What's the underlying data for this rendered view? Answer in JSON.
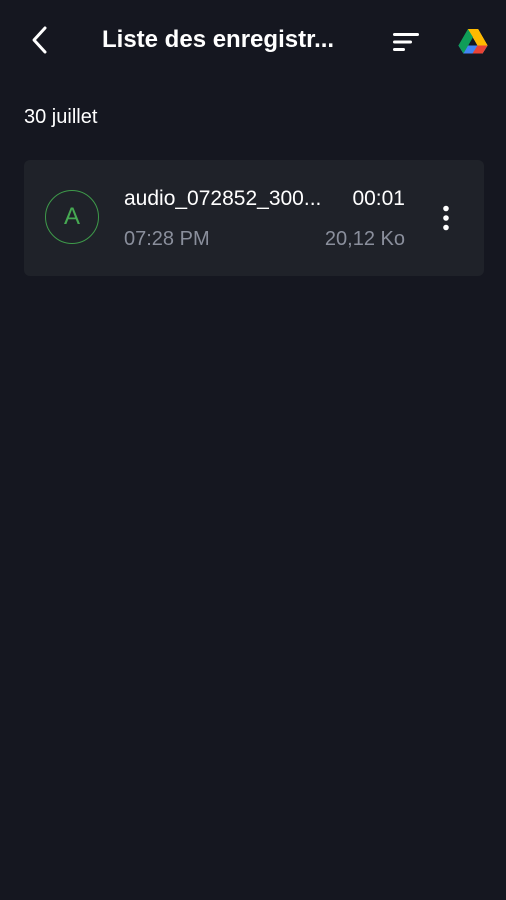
{
  "header": {
    "back_icon": "chevron-left-icon",
    "title": "Liste des enregistr...",
    "sort_icon": "sort-icon",
    "drive_icon": "google-drive-icon"
  },
  "section": {
    "date": "30 juillet"
  },
  "recordings": [
    {
      "avatar_letter": "A",
      "avatar_color": "#46a952",
      "name": "audio_072852_300...",
      "duration": "00:01",
      "time": "07:28 PM",
      "size": "20,12 Ko",
      "more_icon": "more-vertical-icon"
    }
  ],
  "colors": {
    "background": "#151720",
    "card": "#1f2229",
    "accent_green": "#46a952",
    "secondary_text": "#8a8f9c"
  }
}
